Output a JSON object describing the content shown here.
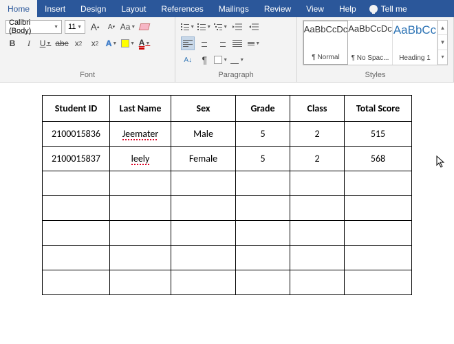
{
  "tabs": {
    "home": "Home",
    "insert": "Insert",
    "design": "Design",
    "layout": "Layout",
    "references": "References",
    "mailings": "Mailings",
    "review": "Review",
    "view": "View",
    "help": "Help",
    "tellme": "Tell me"
  },
  "font": {
    "name": "Calibri (Body)",
    "size": "11",
    "grow": "A",
    "shrink": "A",
    "caseAa": "Aa",
    "bold": "B",
    "italic": "I",
    "underline": "U",
    "strike": "abc",
    "sub": "x",
    "sup": "x",
    "textfx": "A",
    "fontcolor": "A",
    "label": "Font"
  },
  "para": {
    "pilcrow": "¶",
    "label": "Paragraph"
  },
  "styles": {
    "preview": "AaBbCcDc",
    "preview_big": "AaBbCc",
    "normal": "¶ Normal",
    "nospac": "¶ No Spac...",
    "heading1": "Heading 1",
    "label": "Styles"
  },
  "table": {
    "headers": [
      "Student ID",
      "Last Name",
      "Sex",
      "Grade",
      "Class",
      "Total Score"
    ],
    "rows": [
      {
        "id": "2100015836",
        "last": "Jeemater",
        "sex": "Male",
        "grade": "5",
        "class": "2",
        "score": "515",
        "squiggle": true
      },
      {
        "id": "2100015837",
        "last": "leely",
        "sex": "Female",
        "grade": "5",
        "class": "2",
        "score": "568",
        "squiggle": true
      }
    ],
    "empty_rows": 5
  }
}
